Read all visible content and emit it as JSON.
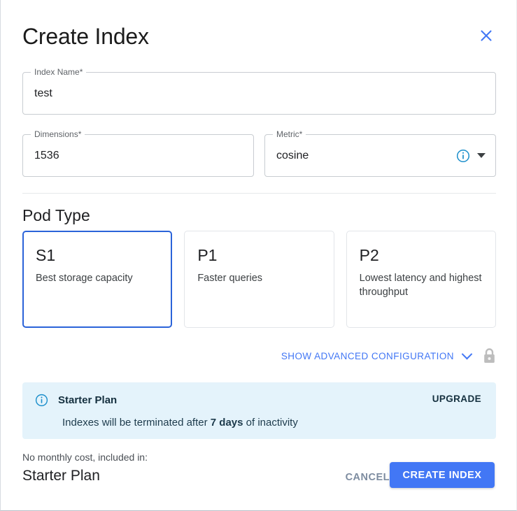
{
  "dialog": {
    "title": "Create Index",
    "close_icon": "close-icon"
  },
  "fields": {
    "index_name": {
      "label": "Index Name",
      "required_mark": "*",
      "value": "test"
    },
    "dimensions": {
      "label": "Dimensions",
      "required_mark": "*",
      "value": "1536"
    },
    "metric": {
      "label": "Metric",
      "required_mark": "*",
      "value": "cosine",
      "info_icon": "info-circle-icon",
      "dropdown_icon": "caret-down-icon"
    }
  },
  "pod_type": {
    "heading": "Pod Type",
    "selected": "S1",
    "options": [
      {
        "name": "S1",
        "description": "Best storage capacity",
        "selected": true
      },
      {
        "name": "P1",
        "description": "Faster queries",
        "selected": false
      },
      {
        "name": "P2",
        "description": "Lowest latency and highest throughput",
        "selected": false
      }
    ]
  },
  "advanced": {
    "label": "SHOW ADVANCED CONFIGURATION",
    "chevron_icon": "chevron-down-icon",
    "lock_icon": "lock-icon"
  },
  "banner": {
    "info_icon": "info-circle-icon",
    "title": "Starter Plan",
    "upgrade_label": "UPGRADE",
    "message_before": "Indexes will be terminated after ",
    "message_highlight": "7 days",
    "message_after": " of inactivity"
  },
  "footer": {
    "cost_label": "No monthly cost, included in:",
    "plan_name": "Starter Plan",
    "cancel_label": "CANCEL",
    "create_label": "CREATE INDEX"
  },
  "colors": {
    "accent_blue": "#4277f5",
    "selected_border": "#2b63d9",
    "banner_bg": "#e4f3fb",
    "banner_text": "#15303f",
    "info_blue": "#1a8ecb",
    "lock_gray": "#bdbdbd",
    "cancel_gray": "#7d8ca0"
  }
}
